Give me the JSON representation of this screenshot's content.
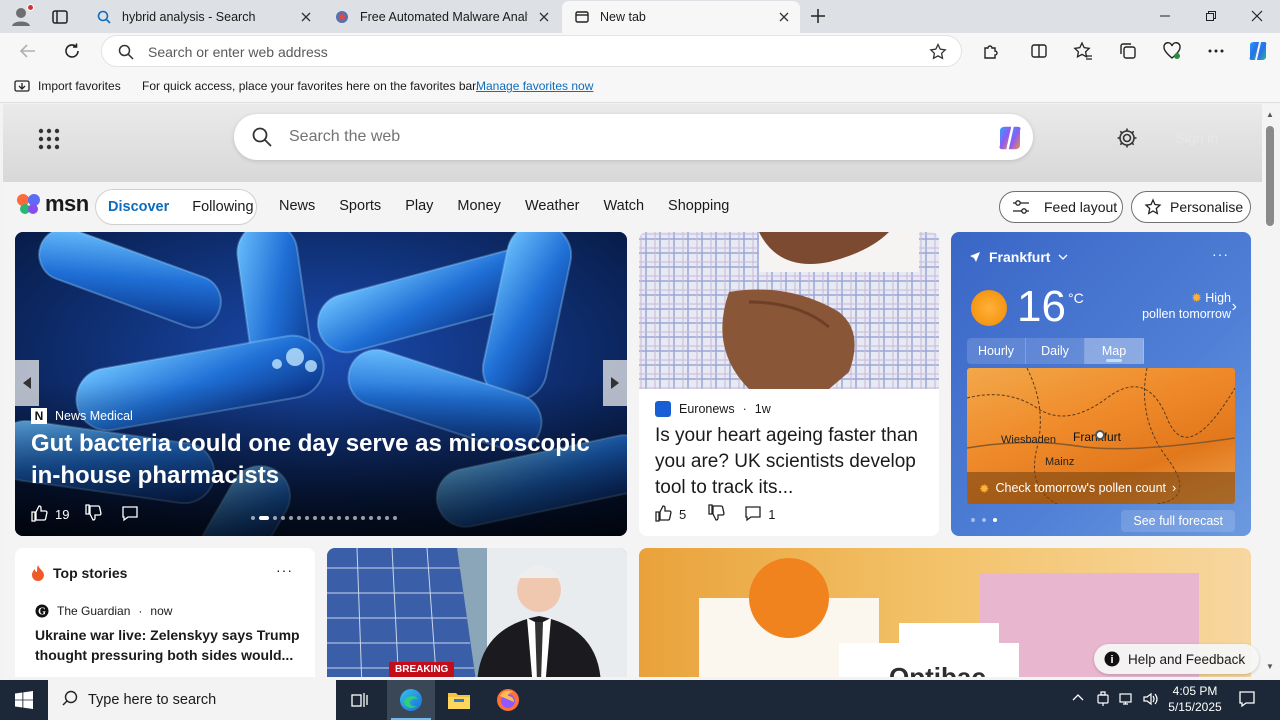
{
  "browser": {
    "tabs": [
      {
        "title": "hybrid analysis - Search",
        "favicon": "search-icon",
        "active": false
      },
      {
        "title": "Free Automated Malware Analysis",
        "favicon": "hybrid-analysis-icon",
        "active": false
      },
      {
        "title": "New tab",
        "favicon": "newtab-icon",
        "active": true
      }
    ],
    "address_placeholder": "Search or enter web address",
    "favorites_bar": {
      "import_label": "Import favorites",
      "hint": "For quick access, place your favorites here on the favorites bar.",
      "manage_link": "Manage favorites now"
    }
  },
  "newtab": {
    "search_placeholder": "Search the web",
    "signin_label": "Sign in",
    "brand": "msn",
    "segments": {
      "discover": "Discover",
      "following": "Following"
    },
    "nav": [
      "News",
      "Sports",
      "Play",
      "Money",
      "Weather",
      "Watch",
      "Shopping"
    ],
    "feed_layout": "Feed layout",
    "personalise": "Personalise"
  },
  "hero": {
    "source": "News Medical",
    "headline": "Gut bacteria could one day serve as microscopic in-house pharmacists",
    "likes": "19"
  },
  "card2": {
    "source": "Euronews",
    "age": "1w",
    "title": "Is your heart ageing faster than you are? UK scientists develop tool to track its...",
    "likes": "5",
    "comments": "1"
  },
  "weather": {
    "location": "Frankfurt",
    "temp": "16",
    "unit": "°C",
    "pollen_level": "High",
    "pollen_when": "pollen tomorrow",
    "tabs": [
      "Hourly",
      "Daily",
      "Map"
    ],
    "active_tab": "Map",
    "map_cities": [
      "Wiesbaden",
      "Frankfurt",
      "Mainz"
    ],
    "pollen_cta": "Check tomorrow's pollen count",
    "full_forecast": "See full forecast"
  },
  "top_stories": {
    "header": "Top stories",
    "source": "The Guardian",
    "age": "now",
    "title": "Ukraine war live: Zelenskyy says Trump thought pressuring both sides would..."
  },
  "breaking_badge": "BREAKING",
  "help_feedback": "Help and Feedback",
  "taskbar": {
    "search_placeholder": "Type here to search",
    "time": "4:05 PM",
    "date": "5/15/2025"
  },
  "colors": {
    "accent": "#0f6cbd",
    "taskbar": "#1c2837",
    "weather_bg": "#3a66c6"
  }
}
